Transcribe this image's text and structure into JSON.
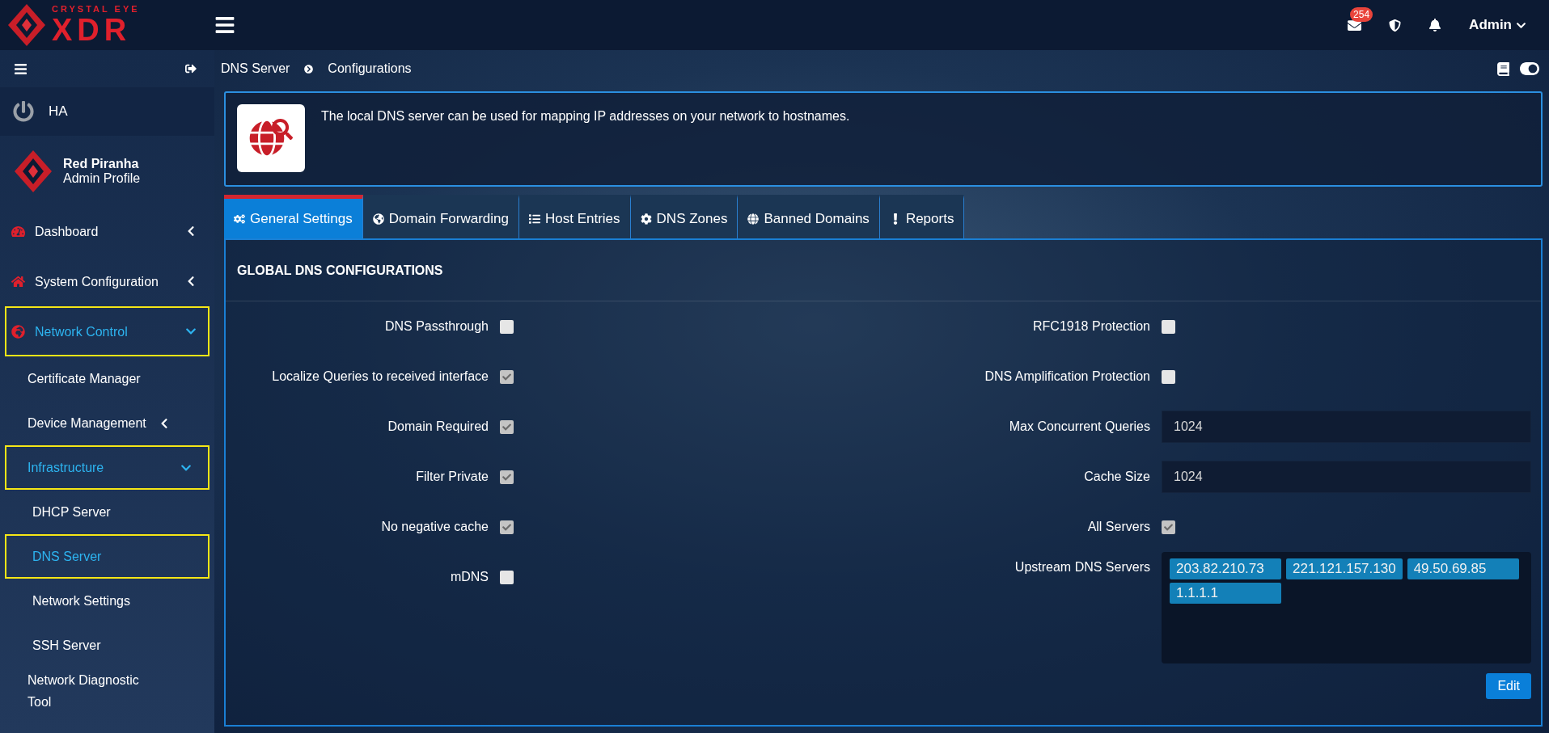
{
  "logo": {
    "tagline": "CRYSTAL EYE",
    "wordmark": "XDR"
  },
  "header": {
    "mail_count": "254",
    "user": "Admin"
  },
  "sidebar": {
    "ha_label": "HA",
    "profile": {
      "name": "Red Piranha",
      "role": "Admin Profile"
    },
    "items": [
      {
        "label": "Dashboard",
        "expanded": false,
        "selected": false,
        "highlighted": false
      },
      {
        "label": "System Configuration",
        "expanded": false,
        "selected": false,
        "highlighted": false
      },
      {
        "label": "Network Control",
        "expanded": true,
        "selected": true,
        "highlighted": true,
        "children": [
          {
            "label": "Certificate Manager",
            "selected": false,
            "highlighted": false
          },
          {
            "label": "Device Management",
            "expanded": false,
            "selected": false,
            "highlighted": false
          },
          {
            "label": "Infrastructure",
            "expanded": true,
            "selected": true,
            "highlighted": true,
            "children": [
              {
                "label": "DHCP Server",
                "selected": false,
                "highlighted": false
              },
              {
                "label": "DNS Server",
                "selected": true,
                "highlighted": true
              },
              {
                "label": "Network Settings",
                "selected": false,
                "highlighted": false
              },
              {
                "label": "SSH Server",
                "selected": false,
                "highlighted": false
              }
            ]
          },
          {
            "label": "Network Diagnostic Tool",
            "selected": false,
            "highlighted": false
          }
        ]
      }
    ]
  },
  "breadcrumb": [
    "DNS Server",
    "Configurations"
  ],
  "info": {
    "text": "The local DNS server can be used for mapping IP addresses on your network to hostnames."
  },
  "tabs": [
    {
      "label": "General Settings",
      "selected": true
    },
    {
      "label": "Domain Forwarding",
      "selected": false
    },
    {
      "label": "Host Entries",
      "selected": false
    },
    {
      "label": "DNS Zones",
      "selected": false
    },
    {
      "label": "Banned Domains",
      "selected": false
    },
    {
      "label": "Reports",
      "selected": false
    }
  ],
  "panel": {
    "title": "GLOBAL DNS CONFIGURATIONS",
    "left_fields": [
      {
        "kind": "checkbox",
        "label": "DNS Passthrough",
        "checked": false
      },
      {
        "kind": "checkbox",
        "label": "Localize Queries to received interface",
        "checked": true
      },
      {
        "kind": "checkbox",
        "label": "Domain Required",
        "checked": true
      },
      {
        "kind": "checkbox",
        "label": "Filter Private",
        "checked": true
      },
      {
        "kind": "checkbox",
        "label": "No negative cache",
        "checked": true
      },
      {
        "kind": "checkbox",
        "label": "mDNS",
        "checked": false
      }
    ],
    "right_fields": [
      {
        "kind": "checkbox",
        "label": "RFC1918 Protection",
        "checked": false
      },
      {
        "kind": "checkbox",
        "label": "DNS Amplification Protection",
        "checked": false
      },
      {
        "kind": "input",
        "label": "Max Concurrent Queries",
        "value": "1024"
      },
      {
        "kind": "input",
        "label": "Cache Size",
        "value": "1024"
      },
      {
        "kind": "checkbox",
        "label": "All Servers",
        "checked": true
      },
      {
        "kind": "tags",
        "label": "Upstream DNS Servers",
        "tags": [
          "203.82.210.73",
          "221.121.157.130",
          "49.50.69.85",
          "1.1.1.1"
        ]
      }
    ],
    "edit_button": "Edit"
  }
}
